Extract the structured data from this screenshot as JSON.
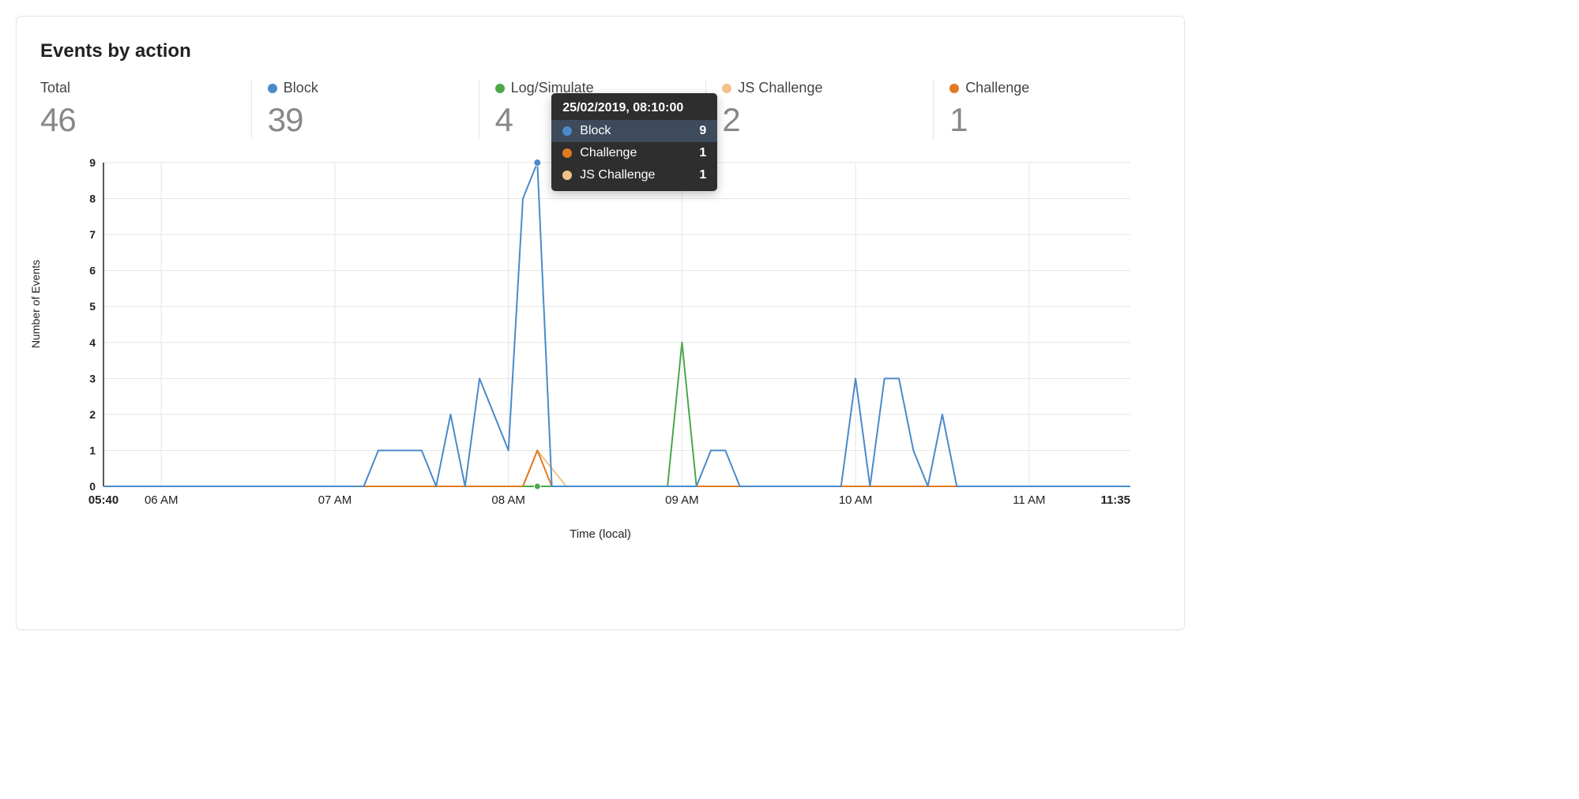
{
  "title": "Events by action",
  "colors": {
    "block": "#4a8ac9",
    "log": "#4aa84a",
    "js": "#f2c288",
    "challenge": "#e07b1f"
  },
  "stats": [
    {
      "key": "total",
      "label": "Total",
      "value": "46",
      "color": null
    },
    {
      "key": "block",
      "label": "Block",
      "value": "39",
      "color": "#4a8ac9"
    },
    {
      "key": "log",
      "label": "Log/Simulate",
      "value": "4",
      "color": "#4aa84a"
    },
    {
      "key": "js",
      "label": "JS Challenge",
      "value": "2",
      "color": "#f2c288"
    },
    {
      "key": "challenge",
      "label": "Challenge",
      "value": "1",
      "color": "#e07b1f"
    }
  ],
  "tooltip": {
    "header": "25/02/2019, 08:10:00",
    "rows": [
      {
        "label": "Block",
        "value": "9",
        "color": "#4a8ac9",
        "highlight": true
      },
      {
        "label": "Challenge",
        "value": "1",
        "color": "#e07b1f",
        "highlight": false
      },
      {
        "label": "JS Challenge",
        "value": "1",
        "color": "#f2c288",
        "highlight": false
      }
    ]
  },
  "chart_data": {
    "type": "line",
    "title": "Events by action",
    "xlabel": "Time (local)",
    "ylabel": "Number of Events",
    "ylim": [
      0,
      9
    ],
    "y_ticks": [
      0,
      1,
      2,
      3,
      4,
      5,
      6,
      7,
      8,
      9
    ],
    "x_range_labels": [
      "05:40",
      "11:35"
    ],
    "x_tick_labels": [
      "06 AM",
      "07 AM",
      "08 AM",
      "09 AM",
      "10 AM",
      "11 AM"
    ],
    "x_tick_minutes": [
      360,
      420,
      480,
      540,
      600,
      660
    ],
    "x_min_minute": 340,
    "x_max_minute": 695,
    "series": [
      {
        "name": "Block",
        "color": "#4a8ac9",
        "points": [
          [
            340,
            0
          ],
          [
            430,
            0
          ],
          [
            435,
            1
          ],
          [
            440,
            1
          ],
          [
            445,
            1
          ],
          [
            450,
            1
          ],
          [
            455,
            0
          ],
          [
            460,
            2
          ],
          [
            465,
            0
          ],
          [
            470,
            3
          ],
          [
            475,
            2
          ],
          [
            480,
            1
          ],
          [
            485,
            8
          ],
          [
            490,
            9
          ],
          [
            495,
            0
          ],
          [
            500,
            0
          ],
          [
            545,
            0
          ],
          [
            550,
            1
          ],
          [
            555,
            1
          ],
          [
            560,
            0
          ],
          [
            595,
            0
          ],
          [
            600,
            3
          ],
          [
            605,
            0
          ],
          [
            610,
            3
          ],
          [
            615,
            3
          ],
          [
            620,
            1
          ],
          [
            625,
            0
          ],
          [
            630,
            2
          ],
          [
            635,
            0
          ],
          [
            695,
            0
          ]
        ]
      },
      {
        "name": "Log/Simulate",
        "color": "#4aa84a",
        "points": [
          [
            340,
            0
          ],
          [
            535,
            0
          ],
          [
            540,
            4
          ],
          [
            545,
            0
          ],
          [
            695,
            0
          ]
        ]
      },
      {
        "name": "JS Challenge",
        "color": "#f2c288",
        "points": [
          [
            340,
            0
          ],
          [
            485,
            0
          ],
          [
            490,
            1
          ],
          [
            500,
            0
          ],
          [
            695,
            0
          ]
        ]
      },
      {
        "name": "Challenge",
        "color": "#e07b1f",
        "points": [
          [
            340,
            0
          ],
          [
            485,
            0
          ],
          [
            490,
            1
          ],
          [
            495,
            0
          ],
          [
            695,
            0
          ]
        ]
      }
    ],
    "highlight_point": {
      "series": "Block",
      "x": 490,
      "y": 9
    },
    "highlight_marker": {
      "x": 490,
      "y": 0,
      "color": "#4aa84a"
    }
  }
}
